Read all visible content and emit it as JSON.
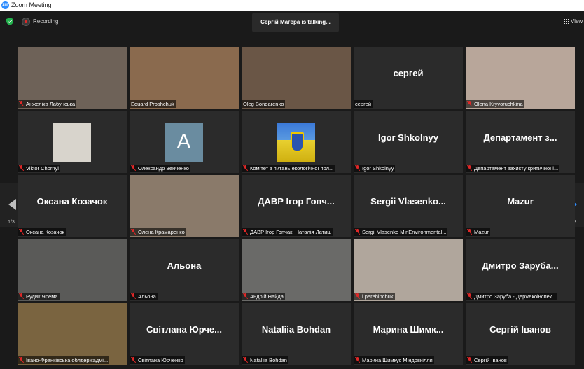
{
  "window": {
    "title": "Zoom Meeting",
    "logo_text": "zm"
  },
  "toolbar": {
    "recording_label": "Recording",
    "view_label": "View"
  },
  "active_speaker": "Сергій Магера is talking...",
  "pagination": {
    "prev_label": "1/3",
    "next_label": "1/3"
  },
  "colors": {
    "accent": "#2d8cff",
    "muted": "#e02828",
    "tile_bg": "#2b2b2b"
  },
  "participants": [
    {
      "label": "Анжеліка Лабунська",
      "display": "",
      "video": true,
      "muted": true,
      "bg": "#6e6258"
    },
    {
      "label": "Eduard Proshchuk",
      "display": "",
      "video": true,
      "muted": false,
      "bg": "#8a6a4e"
    },
    {
      "label": "Oleg Bondarenko",
      "display": "",
      "video": true,
      "muted": false,
      "bg": "#6a5646"
    },
    {
      "label": "сергей",
      "display": "сергей",
      "video": false,
      "muted": false,
      "bg": ""
    },
    {
      "label": "Olena Kryvoruchkina",
      "display": "",
      "video": true,
      "muted": true,
      "bg": "#b8a69a"
    },
    {
      "label": "Viktor Chornyi",
      "display": "",
      "video": true,
      "muted": true,
      "bg": "#2b2b2b",
      "photo": true
    },
    {
      "label": "Олександр Зенченко",
      "display": "",
      "video": false,
      "muted": true,
      "avatar": "A"
    },
    {
      "label": "Комітет з питань екологічної пол...",
      "display": "",
      "video": false,
      "muted": true,
      "flag": true
    },
    {
      "label": "Igor Shkolnyy",
      "display": "Igor Shkolnyy",
      "video": false,
      "muted": true,
      "bg": ""
    },
    {
      "label": "Департамент захисту критичної і...",
      "display": "Департамент з...",
      "video": false,
      "muted": true,
      "bg": ""
    },
    {
      "label": "Оксана Козачок",
      "display": "Оксана Козачок",
      "video": false,
      "muted": true,
      "bg": ""
    },
    {
      "label": "Олена Крамаренко",
      "display": "",
      "video": true,
      "muted": true,
      "bg": "#8a7a6a"
    },
    {
      "label": "ДАВР Ігор Гопчак, Наталія Латиш",
      "display": "ДАВР Ігор Гопч...",
      "video": false,
      "muted": true,
      "bg": ""
    },
    {
      "label": "Sergii Vlasenko MinEnvironmental...",
      "display": "Sergii Vlasenko...",
      "video": false,
      "muted": true,
      "bg": ""
    },
    {
      "label": "Mazur",
      "display": "Mazur",
      "video": false,
      "muted": true,
      "bg": ""
    },
    {
      "label": "Рудик Ярема",
      "display": "",
      "video": true,
      "muted": true,
      "bg": "#5a5a58"
    },
    {
      "label": "Альона",
      "display": "Альона",
      "video": false,
      "muted": true,
      "bg": ""
    },
    {
      "label": "Андрій Найда",
      "display": "",
      "video": true,
      "muted": true,
      "bg": "#6a6a68"
    },
    {
      "label": "i.perehinchuk",
      "display": "",
      "video": true,
      "muted": true,
      "bg": "#b0a69c"
    },
    {
      "label": "Дмитро Заруба - Держекоінспек...",
      "display": "Дмитро Заруба...",
      "video": false,
      "muted": true,
      "bg": ""
    },
    {
      "label": "Івано-Франківська облдержадмі...",
      "display": "",
      "video": true,
      "muted": true,
      "bg": "#7a6440"
    },
    {
      "label": "Світлана Юрченко",
      "display": "Світлана Юрче...",
      "video": false,
      "muted": true,
      "bg": ""
    },
    {
      "label": "Nataliia Bohdan",
      "display": "Nataliia Bohdan",
      "video": false,
      "muted": true,
      "bg": ""
    },
    {
      "label": "Марина Шимкус Міндовкілля",
      "display": "Марина Шимк...",
      "video": false,
      "muted": true,
      "bg": ""
    },
    {
      "label": "Сергій Іванов",
      "display": "Сергій Іванов",
      "video": false,
      "muted": true,
      "bg": ""
    }
  ]
}
